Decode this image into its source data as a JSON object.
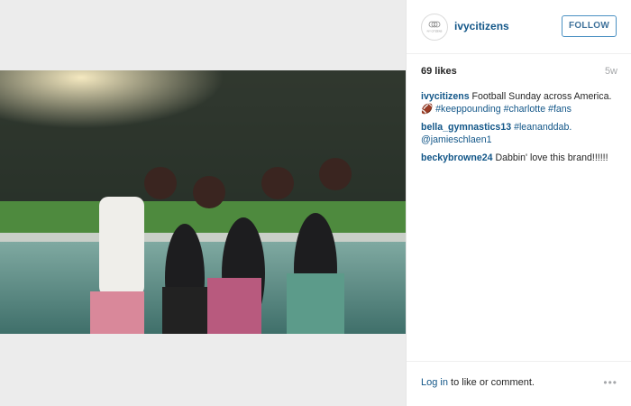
{
  "post": {
    "author": "ivycitizens",
    "avatar_text": "IVY CITIZENS",
    "follow_label": "FOLLOW",
    "likes": "69 likes",
    "age": "5w"
  },
  "comments": [
    {
      "user": "ivycitizens",
      "text": " Football Sunday across America. 🏈 ",
      "tags": [
        "#keeppounding",
        "#charlotte",
        "#fans"
      ]
    },
    {
      "user": "bella_gymnastics13",
      "text": " ",
      "tags": [
        "#leananddab.",
        "@jamieschlaen1"
      ]
    },
    {
      "user": "beckybrowne24",
      "text": " Dabbin' love this brand!!!!!!",
      "tags": []
    }
  ],
  "footer": {
    "login_link": "Log in",
    "login_rest": " to like or comment.",
    "more_icon": "•••"
  }
}
